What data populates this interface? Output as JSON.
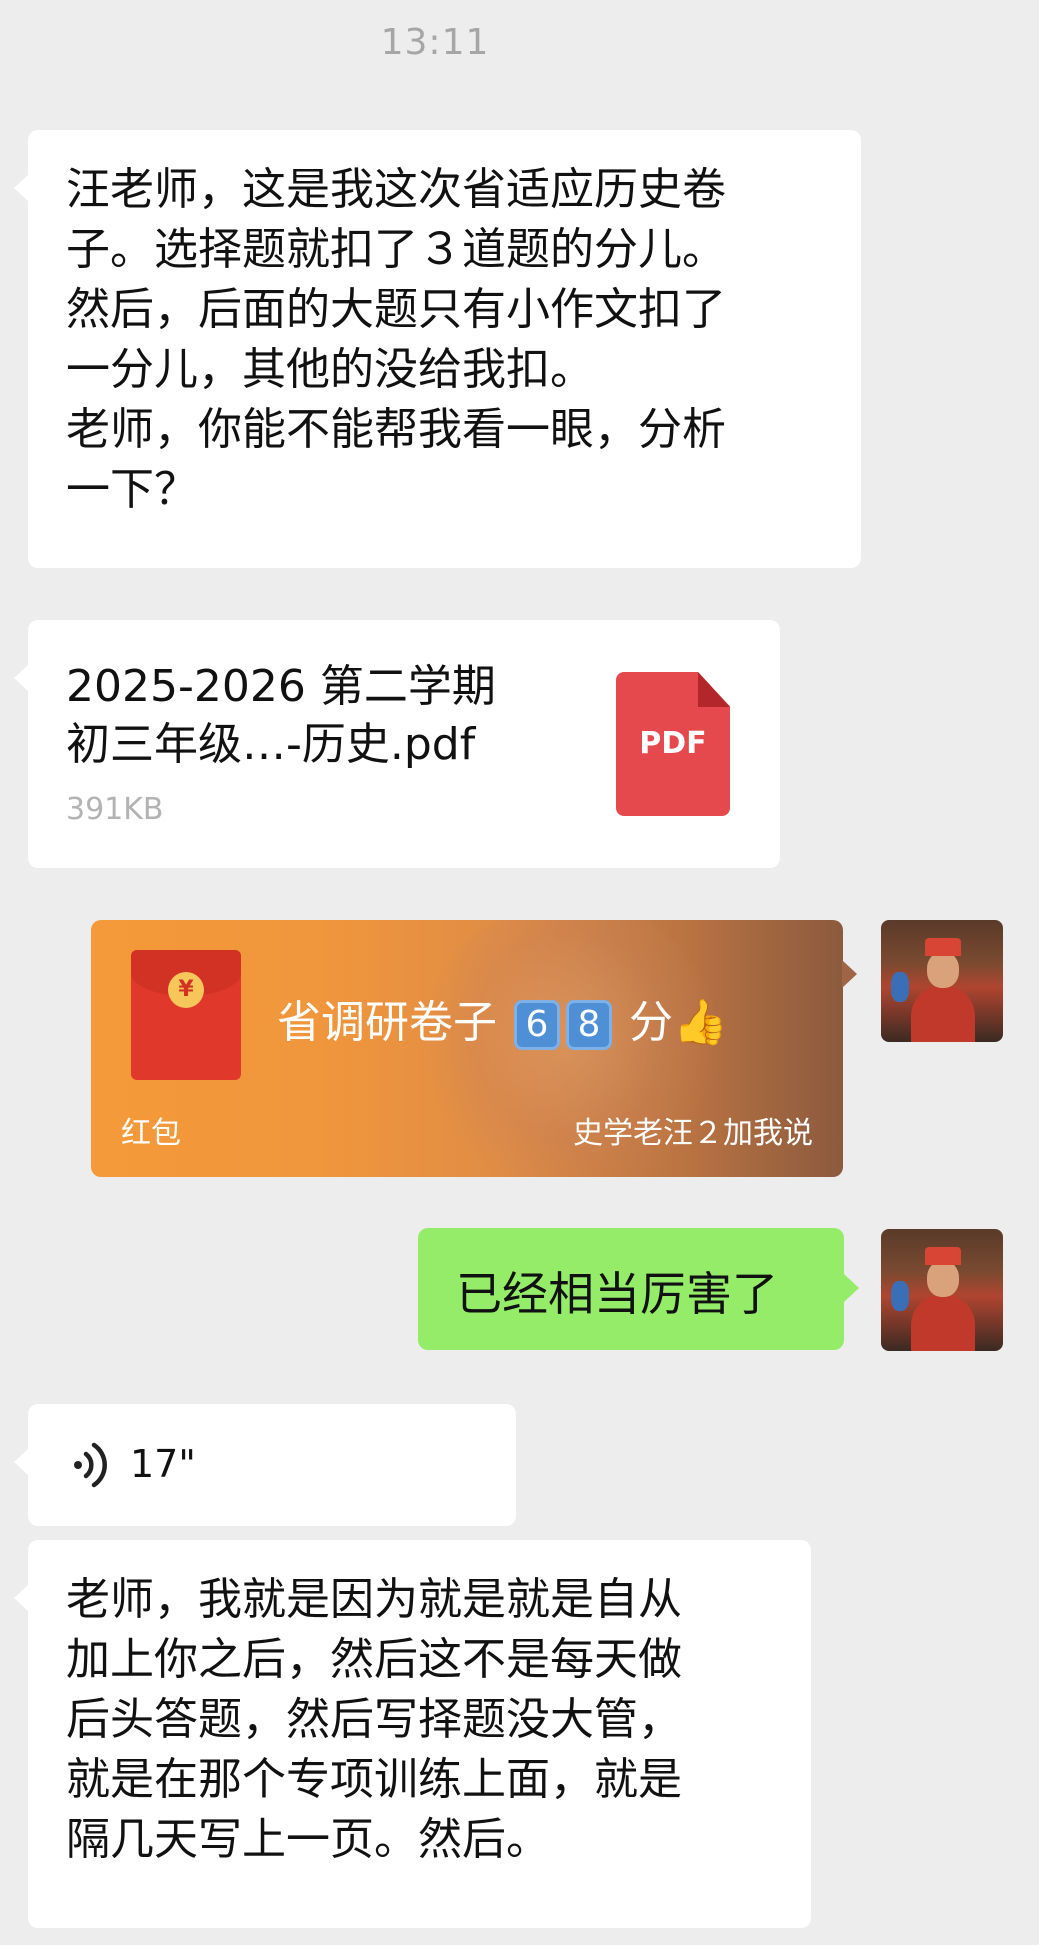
{
  "time": "13:11",
  "messages": [
    {
      "text": "汪老师，这是我这次省适应历史卷\n子。选择题就扣了３道题的分儿。\n然后，后面的大题只有小作文扣了\n一分儿，其他的没给我扣。\n老师，你能不能帮我看一眼，分析\n一下？"
    },
    {
      "file_name": "2025-2026 第二学期\n初三年级…-历史.pdf",
      "file_size": "391KB",
      "file_icon": "PDF"
    },
    {
      "packet_title": "省调研卷子",
      "packet_digit1": "6",
      "packet_digit2": "8",
      "packet_suffix": "分",
      "packet_emoji": "👍",
      "packet_label": "红包",
      "packet_sender": "史学老汪２加我说",
      "packet_coin": "¥"
    },
    {
      "text": "已经相当厉害了"
    },
    {
      "voice_duration": "17\""
    },
    {
      "text": "老师，我就是因为就是就是自从\n加上你之后，然后这不是每天做\n后头答题，然后写择题没大管，\n就是在那个专项训练上面，就是\n隔几天写上一页。然后。"
    }
  ],
  "colors": {
    "background": "#ededed",
    "sent_bubble": "#95ec69",
    "received_bubble": "#ffffff",
    "red_packet": "#f49a3a",
    "pdf_icon": "#e5484d"
  },
  "icons": {
    "voice": "voice-wave-icon",
    "pdf": "pdf-file-icon",
    "avatar": "user-avatar"
  }
}
